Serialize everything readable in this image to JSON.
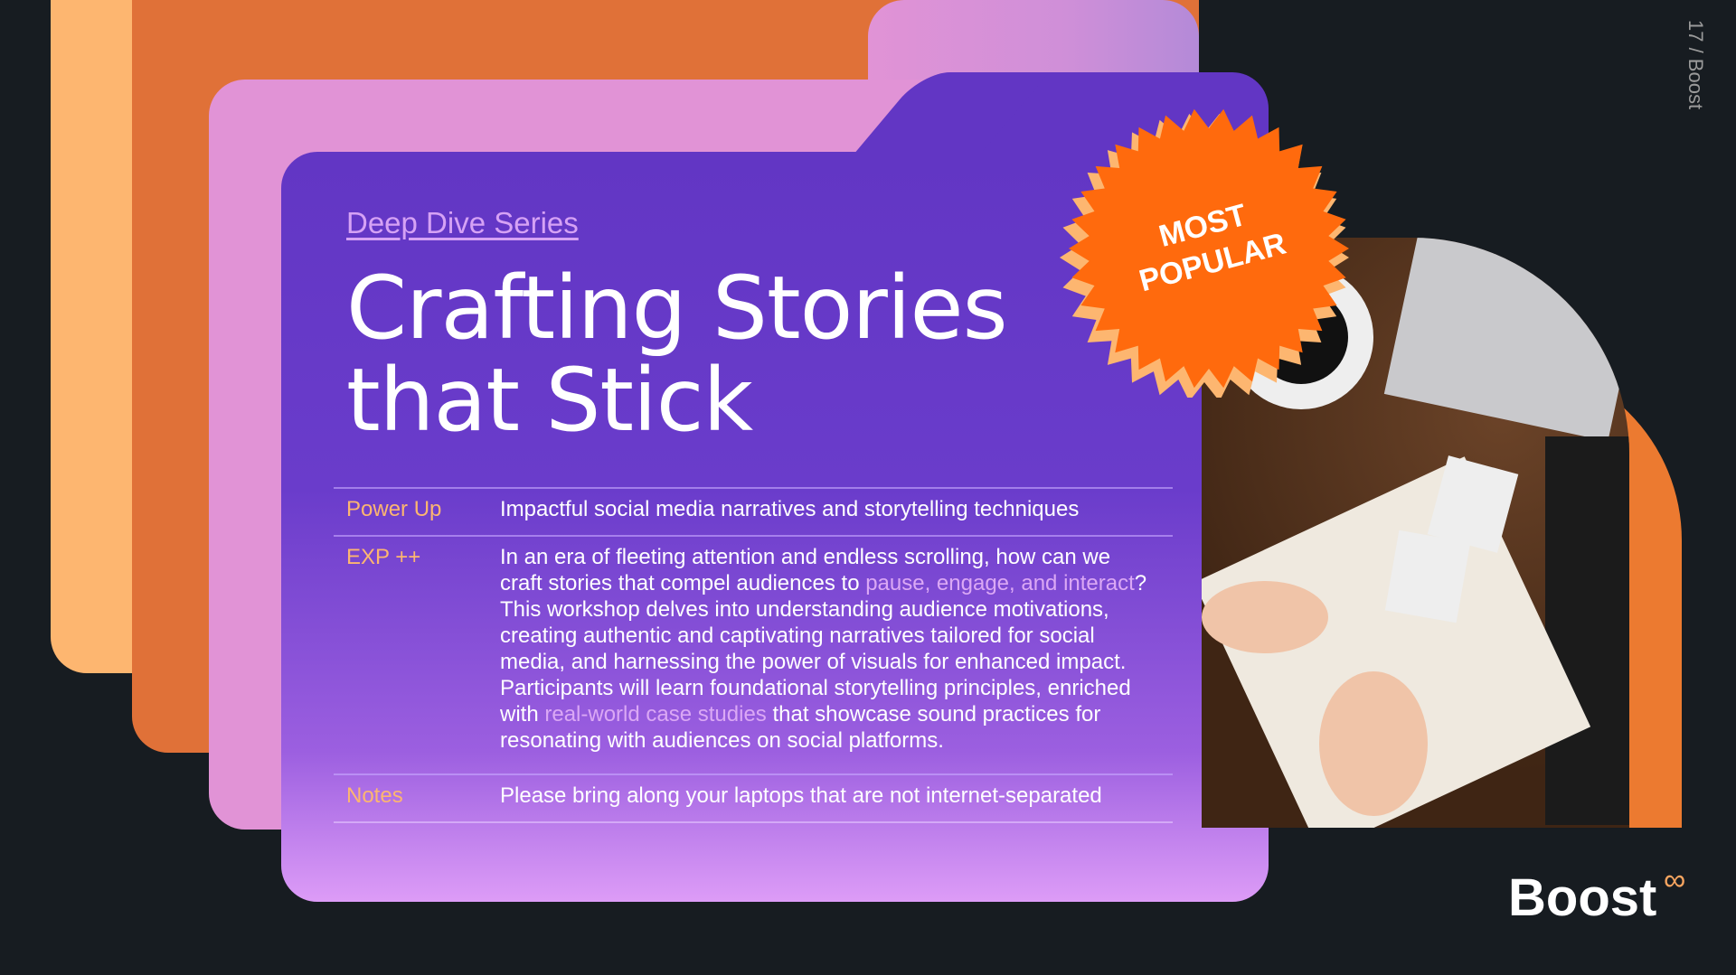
{
  "series_label": "Deep Dive Series",
  "title_line1": "Crafting Stories",
  "title_line2": "that Stick",
  "badge": {
    "line1": "MOST",
    "line2": "POPULAR"
  },
  "rows": [
    {
      "key": "Power Up",
      "value": "Impactful social media narratives and storytelling techniques"
    },
    {
      "key": "EXP ++",
      "parts": [
        "In an era of fleeting attention and endless scrolling, how can we craft stories that compel audiences to ",
        "pause, engage, and interact",
        "? This workshop delves into understanding audience motivations, creating authentic and captivating narratives tailored for social media, and harnessing the power of visuals for enhanced impact. Participants will learn foundational storytelling principles, enriched with ",
        "real-world case studies",
        " that showcase sound practices for resonating with audiences on social platforms."
      ]
    },
    {
      "key": "Notes",
      "value": "Please bring along your laptops that are not internet-separated"
    }
  ],
  "page_indicator": "17 / Boost",
  "logo": "Boost",
  "colors": {
    "bg": "#171c21",
    "purple": "#6236c4",
    "orange": "#ff6a0d",
    "peach": "#fdb670"
  }
}
